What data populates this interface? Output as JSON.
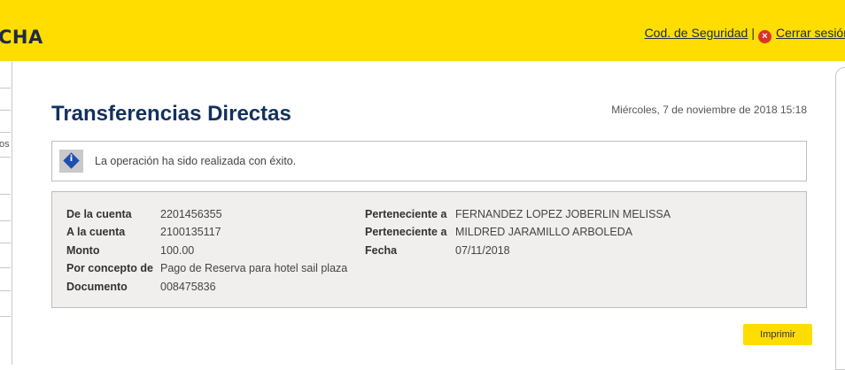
{
  "header": {
    "logo_fragment": "CHA",
    "security_link": "Cod. de Seguridad",
    "separator": "|",
    "logout_link": "Cerrar sesión"
  },
  "sidebar": {
    "fragment": "os"
  },
  "page": {
    "title": "Transferencias Directas",
    "date": "Miércoles, 7 de noviembre de 2018 15:18"
  },
  "message": {
    "text": "La operación ha sido realizada con éxito."
  },
  "details": {
    "from_account_label": "De la cuenta",
    "from_account_value": "2201456355",
    "from_owner_label": "Perteneciente a",
    "from_owner_value": "FERNANDEZ LOPEZ JOBERLIN MELISSA",
    "to_account_label": "A la cuenta",
    "to_account_value": "2100135117",
    "to_owner_label": "Perteneciente a",
    "to_owner_value": "MILDRED JARAMILLO ARBOLEDA",
    "amount_label": "Monto",
    "amount_value": "100.00",
    "date_label": "Fecha",
    "date_value": "07/11/2018",
    "concept_label": "Por concepto de",
    "concept_value": "Pago de Reserva para hotel sail plaza",
    "document_label": "Documento",
    "document_value": "008475836"
  },
  "actions": {
    "print_label": "Imprimir"
  },
  "colors": {
    "brand_yellow": "#ffdd00",
    "title_blue": "#12315e"
  },
  "icons": [
    "close-circle-icon",
    "info-diamond-icon"
  ]
}
